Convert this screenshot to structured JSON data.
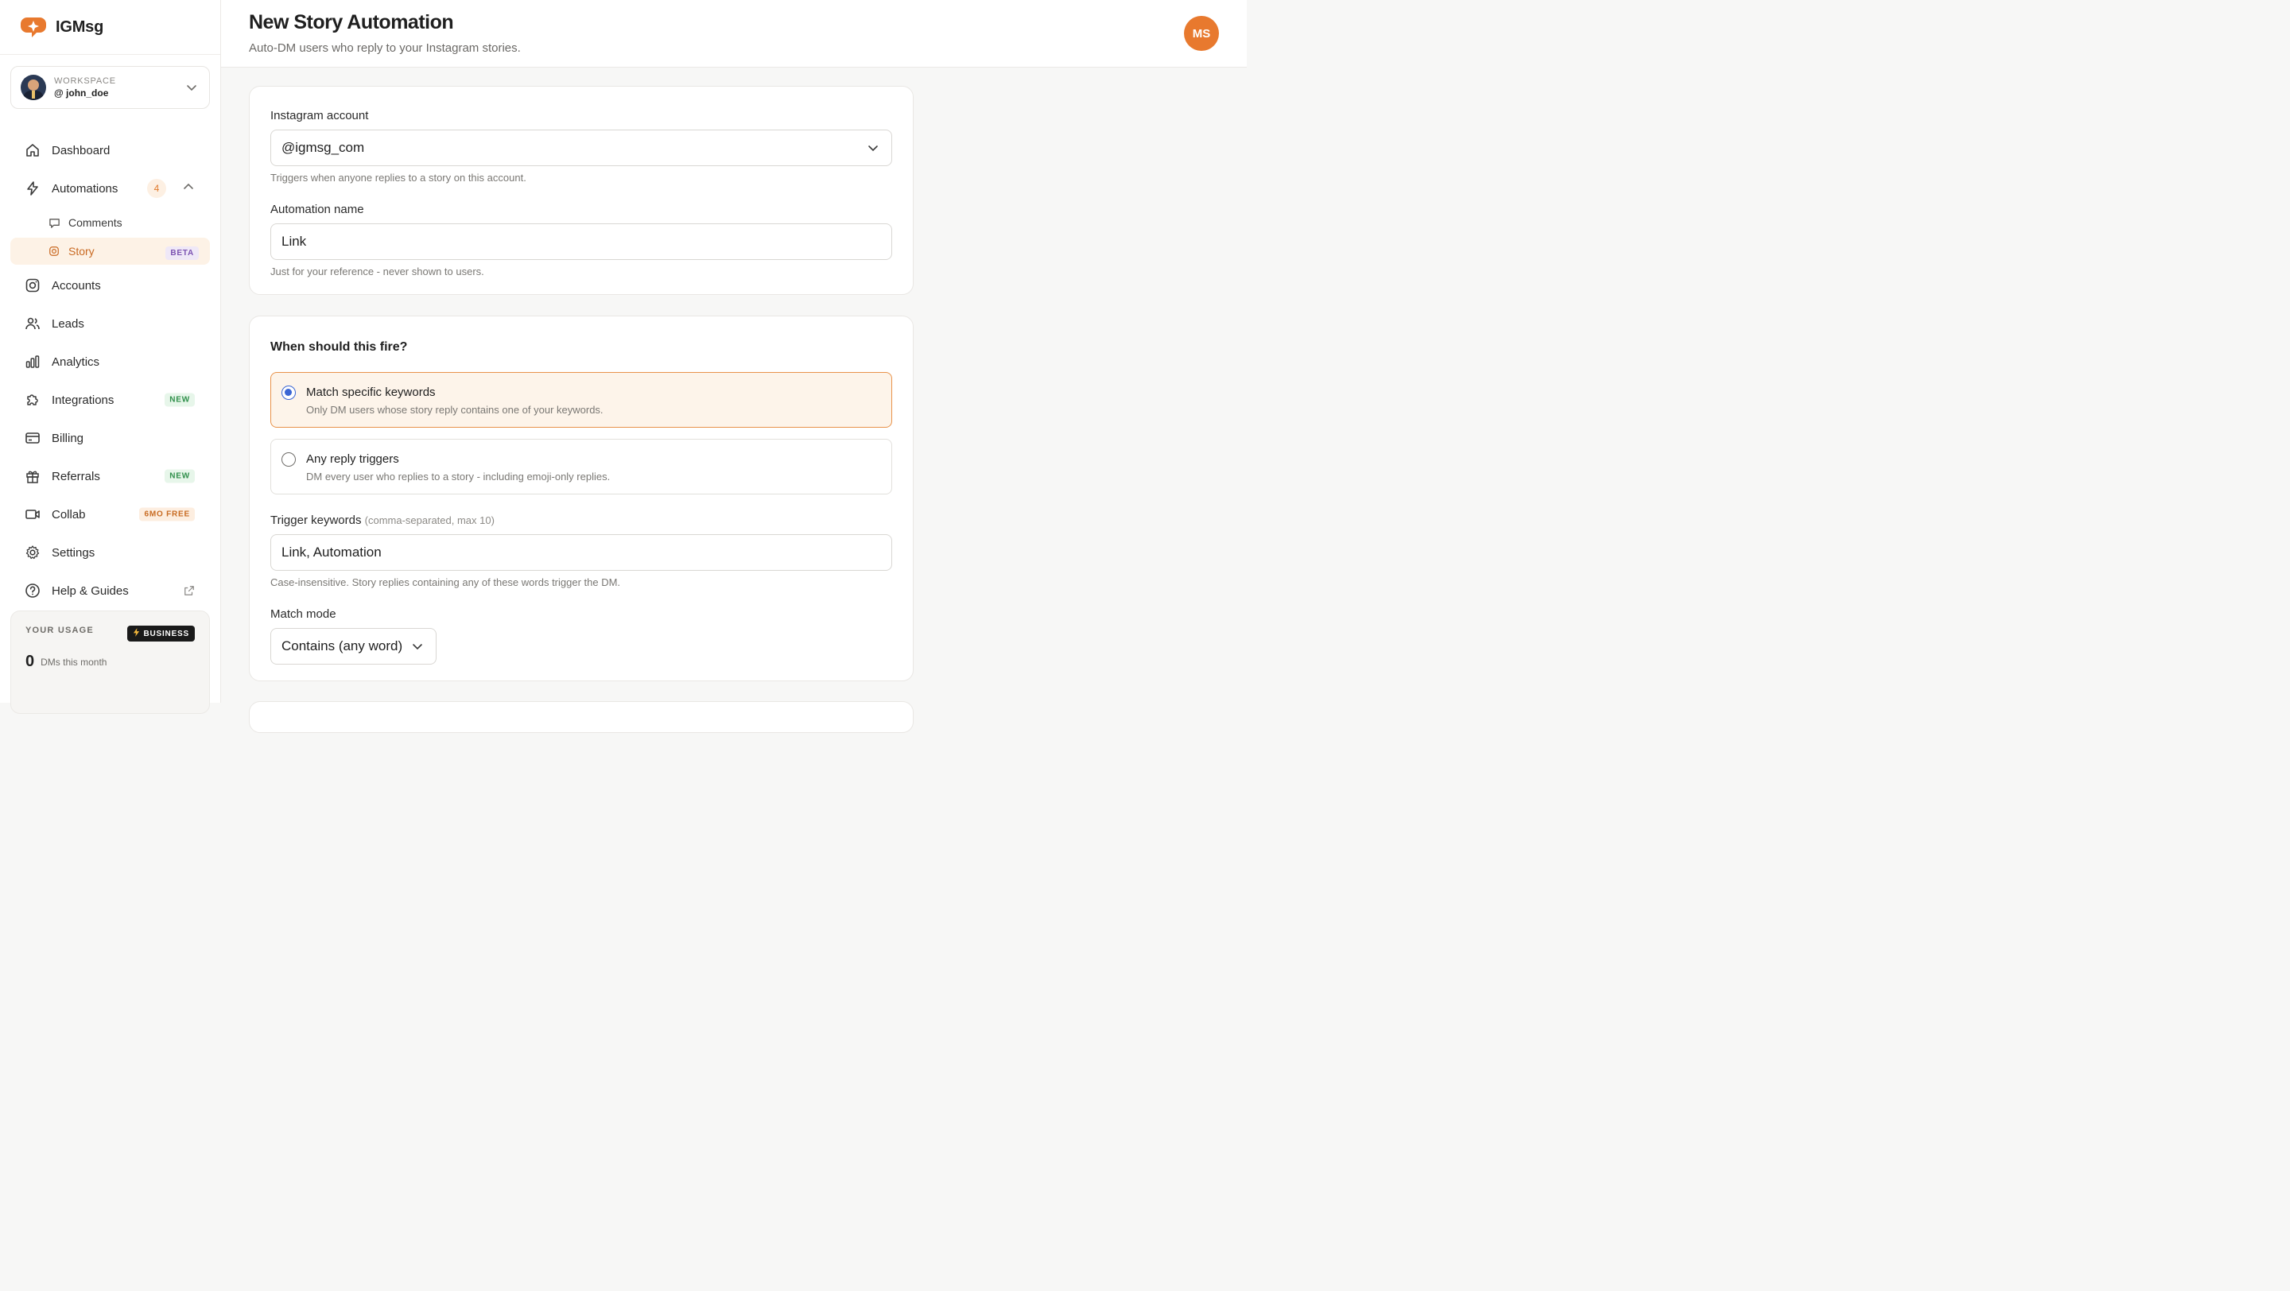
{
  "brand": {
    "name": "IGMsg",
    "color": "#e8792e"
  },
  "workspace": {
    "label": "WORKSPACE",
    "user": "@ john_doe"
  },
  "nav": {
    "dashboard": "Dashboard",
    "automations": {
      "label": "Automations",
      "count": "4"
    },
    "sub": {
      "comments": "Comments",
      "story": {
        "label": "Story",
        "badge": "BETA"
      }
    },
    "accounts": "Accounts",
    "leads": "Leads",
    "analytics": "Analytics",
    "integrations": {
      "label": "Integrations",
      "badge": "NEW"
    },
    "billing": "Billing",
    "referrals": {
      "label": "Referrals",
      "badge": "NEW"
    },
    "collab": {
      "label": "Collab",
      "badge": "6MO FREE"
    },
    "settings": "Settings",
    "help": "Help & Guides"
  },
  "usage": {
    "title": "YOUR USAGE",
    "plan": "BUSINESS",
    "count": "0",
    "label": "DMs this month"
  },
  "header": {
    "title": "New Story Automation",
    "subtitle": "Auto-DM users who reply to your Instagram stories.",
    "avatar_initials": "MS"
  },
  "form": {
    "account": {
      "label": "Instagram account",
      "value": "@igmsg_com",
      "help": "Triggers when anyone replies to a story on this account."
    },
    "name": {
      "label": "Automation name",
      "value": "Link",
      "help": "Just for your reference - never shown to users."
    },
    "trigger": {
      "title": "When should this fire?",
      "options": [
        {
          "title": "Match specific keywords",
          "desc": "Only DM users whose story reply contains one of your keywords."
        },
        {
          "title": "Any reply triggers",
          "desc": "DM every user who replies to a story - including emoji-only replies."
        }
      ],
      "selected_index": 0
    },
    "keywords": {
      "label": "Trigger keywords",
      "hint": "(comma-separated, max 10)",
      "value": "Link, Automation",
      "help": "Case-insensitive. Story replies containing any of these words trigger the DM."
    },
    "match_mode": {
      "label": "Match mode",
      "value": "Contains (any word)"
    }
  },
  "colors": {
    "accent": "#e8792e",
    "radio": "#3b66d4",
    "selected_bg": "#fdf4ea"
  }
}
